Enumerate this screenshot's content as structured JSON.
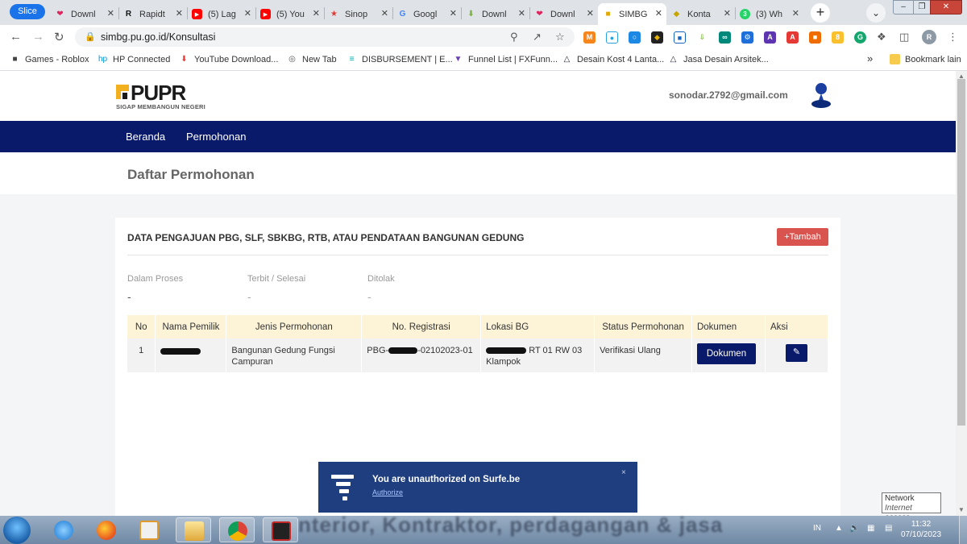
{
  "browser": {
    "slice_label": "Slice",
    "tabs": [
      {
        "title": "Downl",
        "icon": "heart-icon",
        "color": "#e0245e"
      },
      {
        "title": "Rapidt",
        "icon": "r-logo-icon",
        "color": "#111111"
      },
      {
        "title": "(5) Lag",
        "icon": "youtube-icon",
        "color": "#ff0000"
      },
      {
        "title": "(5) You",
        "icon": "youtube-icon",
        "color": "#ff0000"
      },
      {
        "title": "Sinop",
        "icon": "star-icon",
        "color": "#e53935"
      },
      {
        "title": "Googl",
        "icon": "google-translate-icon",
        "color": "#4285f4"
      },
      {
        "title": "Downl",
        "icon": "download-arrow-icon",
        "color": "#7cb342"
      },
      {
        "title": "Downl",
        "icon": "heart-icon",
        "color": "#e0245e"
      },
      {
        "title": "SIMBG",
        "icon": "pupr-icon",
        "color": "#e0a800"
      },
      {
        "title": "Konta",
        "icon": "gov-emblem-icon",
        "color": "#c7a500"
      },
      {
        "title": "(3) Wh",
        "icon": "whatsapp-icon",
        "color": "#25d366"
      }
    ],
    "active_tab_index": 8,
    "url": "simbg.pu.go.id/Konsultasi",
    "bookmarks": [
      {
        "label": "Games - Roblox",
        "icon": "roblox-icon"
      },
      {
        "label": "HP Connected",
        "icon": "hp-icon"
      },
      {
        "label": "YouTube Download...",
        "icon": "download-icon"
      },
      {
        "label": "New Tab",
        "icon": "globe-icon"
      },
      {
        "label": "DISBURSEMENT | E...",
        "icon": "mixtape-icon"
      },
      {
        "label": "Funnel List | FXFunn...",
        "icon": "funnel-icon"
      },
      {
        "label": "Desain Kost 4 Lanta...",
        "icon": "triangle-icon"
      },
      {
        "label": "Jasa Desain Arsitek...",
        "icon": "triangle-icon"
      }
    ],
    "bookmarks_more": "»",
    "other_bookmarks": "Bookmark lain",
    "profile_initial": "R"
  },
  "site": {
    "logo_text": "PUPR",
    "logo_tagline": "SIGAP MEMBANGUN NEGERI",
    "user_email": "sonodar.2792@gmail.com",
    "nav": [
      "Beranda",
      "Permohonan"
    ],
    "page_title": "Daftar Permohonan"
  },
  "card": {
    "title": "DATA PENGAJUAN PBG, SLF, SBKBG, RTB, ATAU PENDATAAN BANGUNAN GEDUNG",
    "add_button": "+Tambah",
    "stats": [
      {
        "label": "Dalam Proses",
        "value": "-"
      },
      {
        "label": "Terbit / Selesai",
        "value": "-"
      },
      {
        "label": "Ditolak",
        "value": "-"
      }
    ],
    "table": {
      "columns": [
        "No",
        "Nama Pemilik",
        "Jenis Permohonan",
        "No. Registrasi",
        "Lokasi BG",
        "Status Permohonan",
        "Dokumen",
        "Aksi"
      ],
      "rows": [
        {
          "no": "1",
          "jenis": "Bangunan Gedung Fungsi Campuran",
          "reg_prefix": "PBG-",
          "reg_suffix": "-02102023-01",
          "lokasi_visible": "RT 01 RW 03 Klampok",
          "status": "Verifikasi Ulang",
          "dokumen_label": "Dokumen",
          "aksi_icon": "edit-icon"
        }
      ]
    }
  },
  "notification": {
    "title": "You are unauthorized on Surfe.be",
    "link": "Authorize",
    "close": "×"
  },
  "taskbar": {
    "language": "IN",
    "time": "11:32",
    "date": "07/10/2023",
    "tooltip_title": "Network",
    "tooltip_sub": "Internet access",
    "blurred_text": "nterior, Kontraktor, perdagangan & jasa"
  },
  "colors": {
    "navy": "#0a1a6b",
    "danger": "#d9534f",
    "table_header": "#fdf4d8",
    "notification_bg": "#1f3e7f"
  }
}
